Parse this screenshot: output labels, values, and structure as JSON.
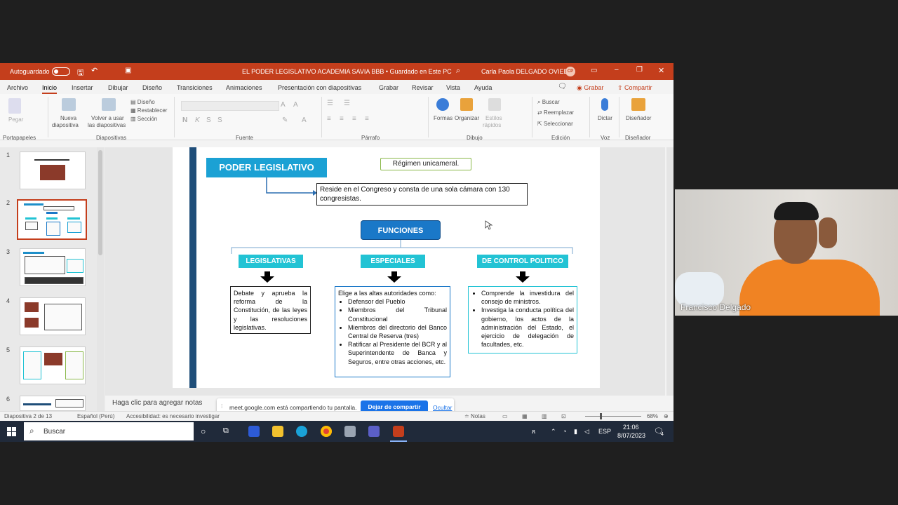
{
  "titlebar": {
    "autosave": "Autoguardado",
    "doc_title": "EL PODER LEGISLATIVO ACADEMIA SAVIA BBB  •  Guardado en Este PC",
    "user": "Carla Paola DELGADO OVIEDO",
    "user_initials": "CP"
  },
  "menu": {
    "items": [
      "Archivo",
      "Inicio",
      "Insertar",
      "Dibujar",
      "Diseño",
      "Transiciones",
      "Animaciones",
      "Presentación con diapositivas",
      "Grabar",
      "Revisar",
      "Vista",
      "Ayuda"
    ],
    "record": "Grabar",
    "share": "Compartir"
  },
  "ribbon": {
    "pegar": "Pegar",
    "nueva": "Nueva",
    "diapositiva": "diapositiva",
    "volver": "Volver a usar",
    "las_diapositivas": "las diapositivas",
    "diseno": "Diseño",
    "restablecer": "Restablecer",
    "seccion": "Sección",
    "formas": "Formas",
    "organizar": "Organizar",
    "estilos": "Estilos",
    "rapidos": "rápidos",
    "buscar": "Buscar",
    "reemplazar": "Reemplazar",
    "seleccionar": "Seleccionar",
    "dictar": "Dictar",
    "disenador": "Diseñador",
    "groups": [
      "Portapapeles",
      "Diapositivas",
      "Fuente",
      "Párrafo",
      "Dibujo",
      "Edición",
      "Voz",
      "Diseñador"
    ]
  },
  "thumbs": [
    "1",
    "2",
    "3",
    "4",
    "5",
    "6"
  ],
  "slide": {
    "title": "PODER LEGISLATIVO",
    "regimen": "Régimen unicameral.",
    "reside": "Reside en el Congreso y consta de una sola cámara con 130 congresistas.",
    "funciones": "FUNCIONES",
    "cat1": "LEGISLATIVAS",
    "cat2": "ESPECIALES",
    "cat3": "DE CONTROL POLITICO",
    "leg_text": "Debate y aprueba la reforma de la Constitución, de las leyes y las resoluciones legislativas.",
    "esp_intro": "Elige a las altas autoridades como:",
    "esp_items": [
      "Defensor del Pueblo",
      "Miembros del Tribunal Constitucional",
      "Miembros del directorio del Banco Central de Reserva (tres)",
      "Ratificar al Presidente del BCR y al Superintendente de Banca y Seguros, entre otras acciones, etc."
    ],
    "ctrl_items": [
      "Comprende la investidura del consejo de ministros.",
      "Investiga la conducta política del gobierno, los actos de la administración del Estado, el ejercicio de delegación de facultades, etc."
    ]
  },
  "notes": {
    "placeholder": "Haga clic para agregar notas"
  },
  "share_bar": {
    "text": "meet.google.com está compartiendo tu pantalla.",
    "stop": "Dejar de compartir",
    "hide": "Ocultar"
  },
  "status": {
    "slide": "Diapositiva 2 de 13",
    "lang": "Español (Perú)",
    "access": "Accesibilidad: es necesario investigar",
    "notes": "Notas",
    "zoom": "68%"
  },
  "taskbar": {
    "search": "Buscar",
    "lang": "ESP",
    "time": "21:06",
    "date": "8/07/2023",
    "notif": "4"
  },
  "webcam": {
    "name": "Francisco Delgado"
  },
  "colors": {
    "ppt_accent": "#c43e1c",
    "title_box": "#1ba1d4",
    "funciones_box": "#1a78c8",
    "category": "#22c3d4",
    "slide_bar": "#1f4e79"
  }
}
